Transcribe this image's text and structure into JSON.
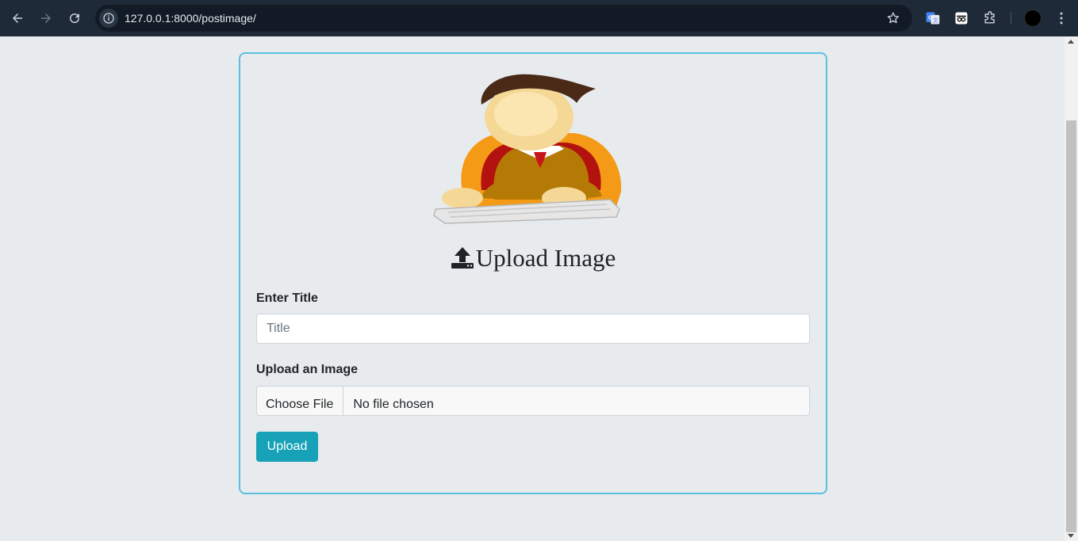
{
  "browser": {
    "url": "127.0.0.1:8000/postimage/"
  },
  "form": {
    "heading": "Upload Image",
    "title_label": "Enter Title",
    "title_placeholder": "Title",
    "image_label": "Upload an Image",
    "file_button": "Choose File",
    "file_status": "No file chosen",
    "submit_label": "Upload"
  },
  "colors": {
    "card_border": "#5bc0de",
    "submit_bg": "#17a2b8",
    "page_bg": "#e8ebee",
    "chrome_bg": "#1f2a38"
  },
  "icons": [
    "back-arrow-icon",
    "forward-arrow-icon",
    "reload-icon",
    "info-icon",
    "star-icon",
    "translate-icon",
    "glasses-icon",
    "puzzle-icon",
    "kebab-menu-icon",
    "upload-icon"
  ]
}
